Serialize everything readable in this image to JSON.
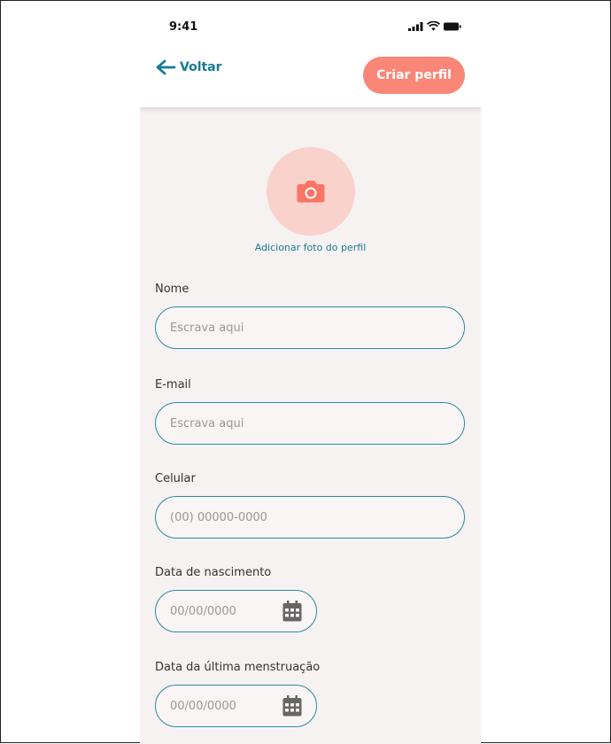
{
  "status_bar": {
    "time": "9:41",
    "icons": [
      "signal-icon",
      "wifi-icon",
      "battery-icon"
    ]
  },
  "header": {
    "back_label": "Voltar",
    "create_label": "Criar perfil"
  },
  "photo": {
    "label": "Adicionar foto do perfil",
    "icon": "camera-icon"
  },
  "form": {
    "name": {
      "label": "Nome",
      "placeholder": "Escrava aqui"
    },
    "email": {
      "label": "E-mail",
      "placeholder": "Escrava aqui"
    },
    "phone": {
      "label": "Celular",
      "placeholder": "(00) 00000-0000"
    },
    "birth_date": {
      "label": "Data de nascimento",
      "placeholder": "00/00/0000"
    },
    "last_period": {
      "label": "Data da última menstruação",
      "placeholder": "00/00/0000"
    }
  },
  "colors": {
    "accent": "#fa8677",
    "accent_light": "#f8d2cb",
    "link": "#177a96",
    "field_border": "#2b8aa5",
    "background": "#f6f2f1"
  }
}
